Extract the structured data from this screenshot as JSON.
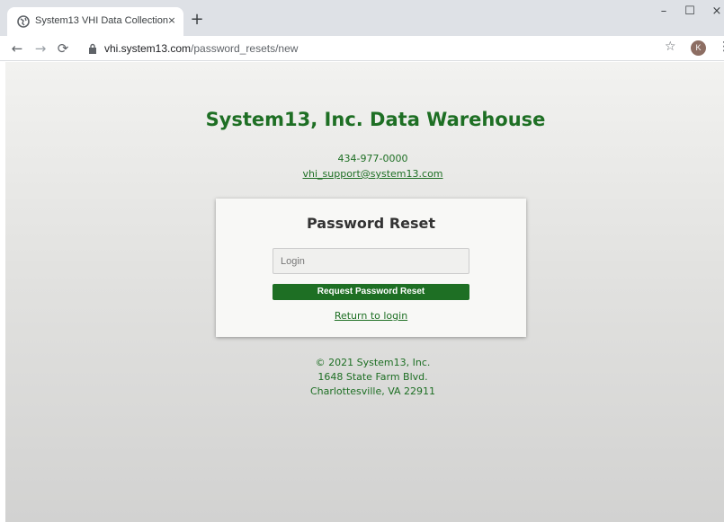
{
  "browser": {
    "tab_title": "System13 VHI Data Collection",
    "tab_close": "×",
    "new_tab": "+",
    "url_domain": "vhi.system13.com",
    "url_path": "/password_resets/new",
    "profile_initial": "K",
    "controls": {
      "minimize": "–",
      "maximize": "☐",
      "close": "×"
    },
    "icons": {
      "back": "arrow-left-icon",
      "forward": "arrow-right-icon",
      "reload": "reload-icon",
      "lock": "lock-icon",
      "star": "star-icon",
      "menu": "kebab-menu-icon"
    }
  },
  "page": {
    "title": "System13, Inc. Data Warehouse",
    "phone": "434-977-0000",
    "email": "vhi_support@system13.com",
    "card": {
      "heading": "Password Reset",
      "login_placeholder": "Login",
      "login_value": "",
      "submit_label": "Request Password Reset",
      "return_link": "Return to login"
    },
    "footer": {
      "copyright": "© 2021 System13, Inc.",
      "address_line1": "1648 State Farm Blvd.",
      "address_line2": "Charlottesville, VA 22911"
    }
  },
  "colors": {
    "brand_green": "#1e6f24",
    "card_bg": "#f8f8f6",
    "tabstrip_bg": "#dee1e6"
  }
}
